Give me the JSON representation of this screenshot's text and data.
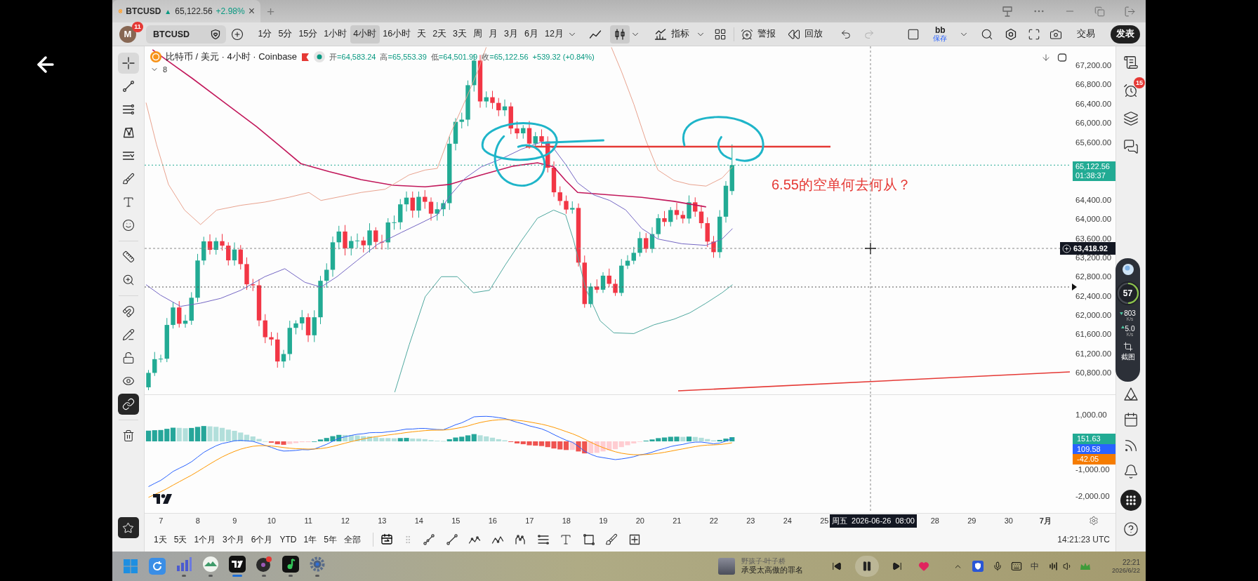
{
  "tab_bar": {
    "tab": {
      "symbol": "BTCUSD",
      "arrow": "▲",
      "price": "65,122.56",
      "change": "+2.98%",
      "close": "×"
    },
    "new_tab": "+"
  },
  "toolbar": {
    "avatar": {
      "initial": "M",
      "badge": "11"
    },
    "symbol": "BTCUSD",
    "intervals": [
      {
        "label": "1分",
        "selected": false
      },
      {
        "label": "5分",
        "selected": false
      },
      {
        "label": "15分",
        "selected": false
      },
      {
        "label": "1小时",
        "selected": false
      },
      {
        "label": "4小时",
        "selected": true
      },
      {
        "label": "16小时",
        "selected": false
      },
      {
        "label": "天",
        "selected": false
      },
      {
        "label": "2天",
        "selected": false
      },
      {
        "label": "3天",
        "selected": false
      },
      {
        "label": "周",
        "selected": false
      },
      {
        "label": "月",
        "selected": false
      },
      {
        "label": "3月",
        "selected": false
      },
      {
        "label": "6月",
        "selected": false
      },
      {
        "label": "12月",
        "selected": false
      }
    ],
    "chart_types": [
      {
        "kind": "line",
        "selected": false
      },
      {
        "kind": "candles",
        "selected": true
      }
    ],
    "indicators": "指标",
    "alerts": "警报",
    "replay": "回放",
    "layout": {
      "name": "bb",
      "status": "保存"
    },
    "trade": "交易",
    "publish": "发表"
  },
  "legend": {
    "title": "比特币 / 美元 · 4小时 · Coinbase",
    "ohlc": [
      {
        "label": "开",
        "value": "=64,583.24"
      },
      {
        "label": "高",
        "value": "=65,553.39"
      },
      {
        "label": "低",
        "value": "=64,501.99"
      },
      {
        "label": "收",
        "value": "=65,122.56"
      }
    ],
    "change": "+539.32 (+0.84%)",
    "indicators_count": "8"
  },
  "left_toolbar": {
    "drawing_tools": [
      {
        "kind": "crosshair",
        "selected": true
      },
      {
        "kind": "trend_line",
        "selected": false
      },
      {
        "kind": "fib",
        "selected": false
      },
      {
        "kind": "pattern",
        "selected": false
      },
      {
        "kind": "position",
        "selected": false
      },
      {
        "kind": "brush",
        "selected": false
      },
      {
        "kind": "text",
        "selected": false
      },
      {
        "kind": "emoji",
        "selected": false
      }
    ],
    "measure_tools": [
      {
        "kind": "ruler",
        "selected": false
      },
      {
        "kind": "zoom",
        "selected": false
      }
    ],
    "toggles": [
      {
        "kind": "magnet",
        "on": false
      },
      {
        "kind": "lock_drawings",
        "on": false
      },
      {
        "kind": "lock",
        "on": false
      },
      {
        "kind": "hide",
        "on": false
      },
      {
        "kind": "sync",
        "on": true
      }
    ]
  },
  "chart": {
    "annotation": "6.55的空单何去何从？"
  },
  "price_axis": {
    "labels": [
      {
        "kind": "tick",
        "text": "67,200.00"
      },
      {
        "kind": "tick",
        "text": "66,800.00"
      },
      {
        "kind": "tick",
        "text": "66,400.00"
      },
      {
        "kind": "tick",
        "text": "66,000.00"
      },
      {
        "kind": "tick",
        "text": "65,600.00"
      },
      {
        "kind": "last_price",
        "text": "65,122.56",
        "countdown": "01:38:37"
      },
      {
        "kind": "tick",
        "text": "64,400.00"
      },
      {
        "kind": "tick",
        "text": "64,000.00"
      },
      {
        "kind": "tick",
        "text": "63,600.00"
      },
      {
        "kind": "tick",
        "text": "63,200.00"
      },
      {
        "kind": "tick",
        "text": "62,800.00"
      },
      {
        "kind": "tick",
        "text": "62,400.00"
      },
      {
        "kind": "tick",
        "text": "62,000.00"
      },
      {
        "kind": "tick",
        "text": "61,600.00"
      },
      {
        "kind": "tick",
        "text": "61,200.00"
      },
      {
        "kind": "tick",
        "text": "60,800.00"
      }
    ],
    "crosshair_price": "63,418.92"
  },
  "macd_axis": {
    "labels": [
      {
        "kind": "tick",
        "text": "1,000.00"
      },
      {
        "kind": "value",
        "text": "151.63",
        "color": "#22ab94"
      },
      {
        "kind": "value",
        "text": "109.58",
        "color": "#2962ff"
      },
      {
        "kind": "value",
        "text": "-42.05",
        "color": "#f57c00"
      },
      {
        "kind": "tick",
        "text": "-1,000.00"
      },
      {
        "kind": "tick",
        "text": "-2,000.00"
      }
    ]
  },
  "time_axis": {
    "labels": [
      {
        "kind": "day",
        "text": "7"
      },
      {
        "kind": "day",
        "text": "8"
      },
      {
        "kind": "day",
        "text": "9"
      },
      {
        "kind": "day",
        "text": "10"
      },
      {
        "kind": "day",
        "text": "11"
      },
      {
        "kind": "day",
        "text": "12"
      },
      {
        "kind": "day",
        "text": "13"
      },
      {
        "kind": "day",
        "text": "14"
      },
      {
        "kind": "day",
        "text": "15"
      },
      {
        "kind": "day",
        "text": "16"
      },
      {
        "kind": "day",
        "text": "17"
      },
      {
        "kind": "day",
        "text": "18"
      },
      {
        "kind": "day",
        "text": "19"
      },
      {
        "kind": "day",
        "text": "20"
      },
      {
        "kind": "day",
        "text": "21"
      },
      {
        "kind": "day",
        "text": "22"
      },
      {
        "kind": "day",
        "text": "23"
      },
      {
        "kind": "day",
        "text": "24"
      },
      {
        "kind": "day",
        "text": "25"
      },
      {
        "kind": "crosshair",
        "text": "周五 2026-06-26 08:00"
      },
      {
        "kind": "day",
        "text": "28"
      },
      {
        "kind": "day",
        "text": "29"
      },
      {
        "kind": "day",
        "text": "30"
      },
      {
        "kind": "month",
        "text": "7月"
      }
    ]
  },
  "bottom_bar": {
    "ranges": [
      "1天",
      "5天",
      "1个月",
      "3个月",
      "6个月",
      "YTD",
      "1年",
      "5年",
      "全部"
    ],
    "clock": "14:21:23 UTC"
  },
  "right_sidebar": {
    "alerts_badge": "15"
  },
  "speed_widget": {
    "cpu": "57",
    "level": 0.5,
    "download": "803",
    "download_unit": "K/s",
    "upload": "5.0",
    "upload_unit": "K/s",
    "screenshot": "截图"
  },
  "taskbar": {
    "apps": [
      {
        "kind": "start",
        "running": false,
        "selected": false
      },
      {
        "kind": "refresh",
        "running": false,
        "selected": false
      },
      {
        "kind": "signal",
        "running": true,
        "selected": false
      },
      {
        "kind": "leaf",
        "running": true,
        "selected": false
      },
      {
        "kind": "tv",
        "running": true,
        "selected": true
      },
      {
        "kind": "disc",
        "running": true,
        "selected": false
      },
      {
        "kind": "music",
        "running": true,
        "selected": false
      },
      {
        "kind": "settings",
        "running": true,
        "selected": false
      }
    ],
    "media": {
      "artist": "野孩子-叶子桥",
      "title": "承受太高傲的罪名",
      "playing": true
    },
    "input_method": "中",
    "time": "22:21",
    "date": "2026/6/22"
  }
}
